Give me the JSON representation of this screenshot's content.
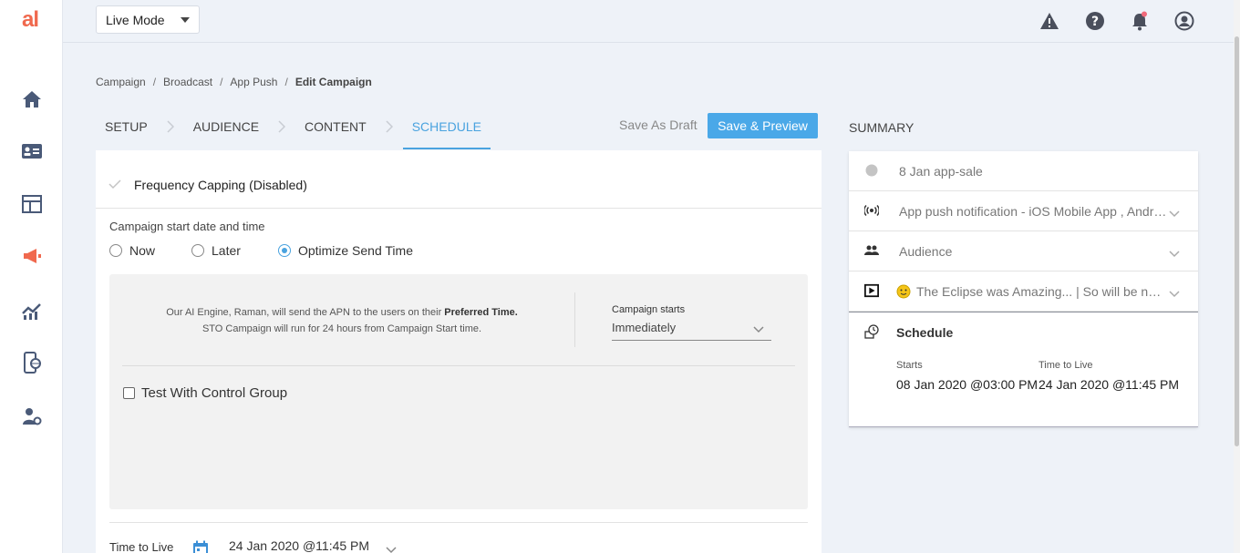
{
  "app": {
    "logo": "al"
  },
  "topbar": {
    "mode_label": "Live Mode"
  },
  "breadcrumb": [
    "Campaign",
    "Broadcast",
    "App Push",
    "Edit Campaign"
  ],
  "steps": [
    "SETUP",
    "AUDIENCE",
    "CONTENT",
    "SCHEDULE"
  ],
  "actions": {
    "draft_label": "Save As Draft",
    "preview_label": "Save & Preview"
  },
  "frequency": {
    "label": "Frequency Capping (Disabled)"
  },
  "start": {
    "label": "Campaign start date and time",
    "options": [
      "Now",
      "Later",
      "Optimize Send Time"
    ],
    "selected": "Optimize Send Time"
  },
  "ai": {
    "line1_prefix": "Our AI Engine, Raman, will send the APN to the users on their ",
    "line1_bold": "Preferred Time.",
    "line2": "STO Campaign will run for 24 hours from Campaign Start time.",
    "campaign_starts_label": "Campaign starts",
    "campaign_starts_value": "Immediately"
  },
  "control_group": {
    "label": "Test With Control Group"
  },
  "ttl": {
    "label": "Time to Live",
    "value": "24 Jan 2020 @11:45 PM"
  },
  "summary": {
    "title": "SUMMARY",
    "items": [
      {
        "text": "8 Jan app-sale"
      },
      {
        "text": "App push notification - iOS Mobile App , Android Mobile App"
      },
      {
        "text": "Audience"
      },
      {
        "text": "The Eclipse was Amazing... | So will be next one"
      },
      {
        "text": "Schedule"
      }
    ],
    "starts_label": "Starts",
    "starts_value": "08 Jan 2020 @03:00 PM",
    "ttl_label": "Time to Live",
    "ttl_value": "24 Jan 2020 @11:45 PM"
  },
  "colors": {
    "accent": "#4aa3df",
    "brand": "#f0694e",
    "button": "#4aa8e8"
  }
}
